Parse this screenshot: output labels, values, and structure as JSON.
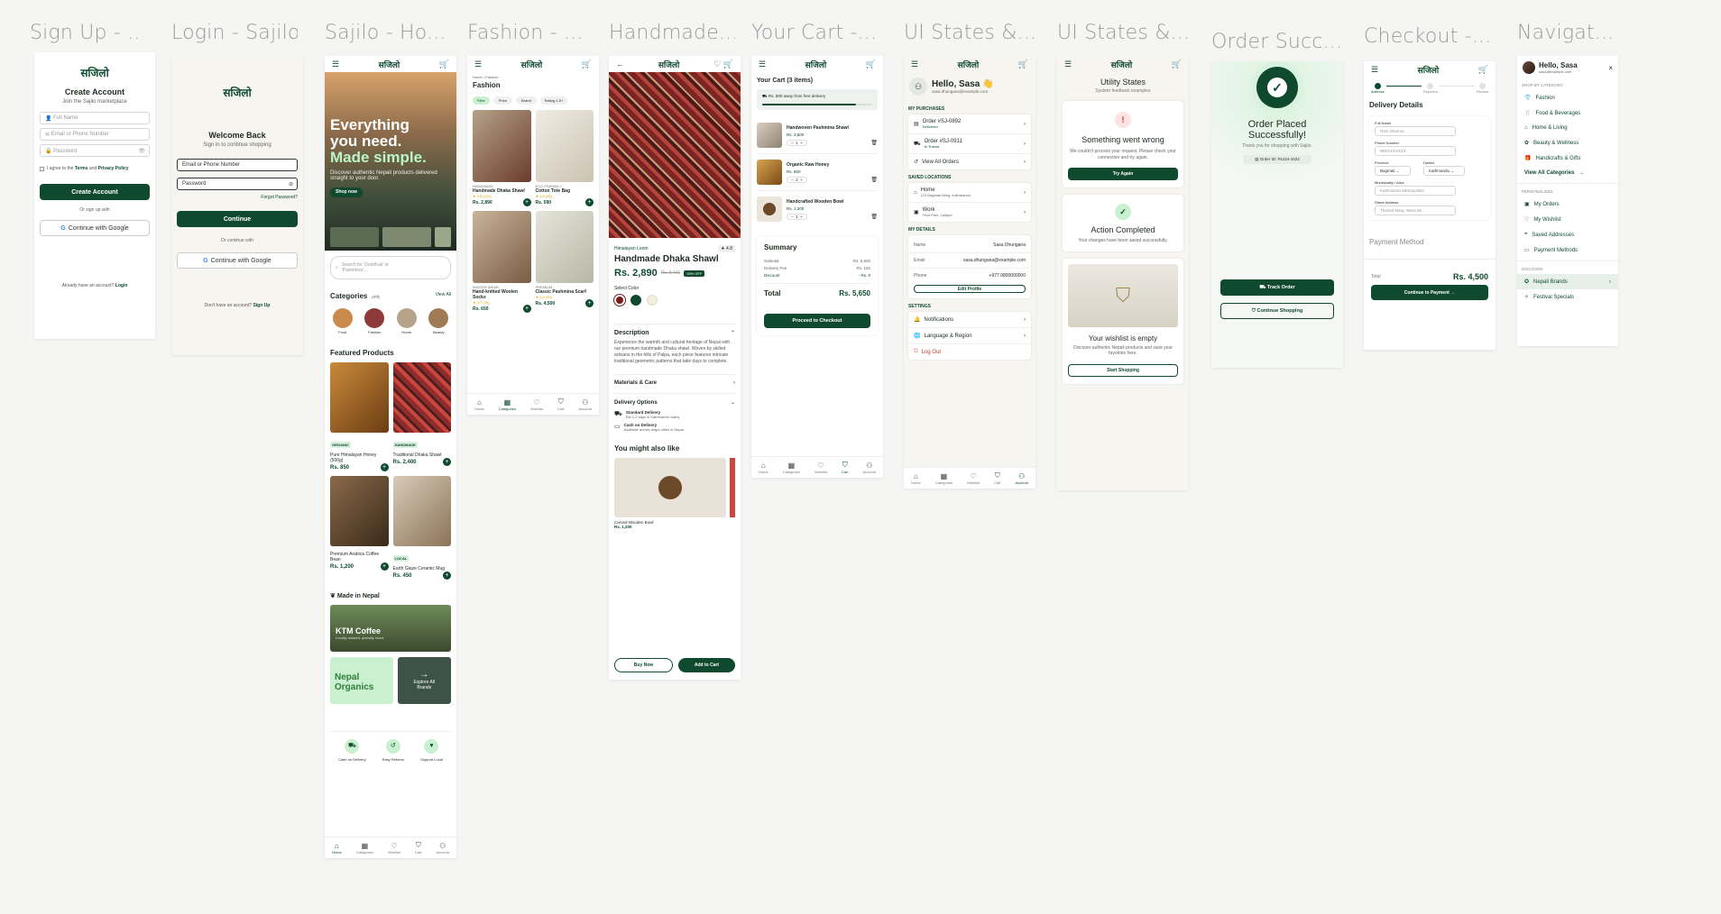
{
  "frames": {
    "titles": [
      "Sign Up - ...",
      "Login - Sajilo",
      "Sajilo - Ho...",
      "Fashion - ...",
      "Handmade...",
      "Your Cart -...",
      "UI States &...",
      "UI States &...",
      "Order Succ...",
      "Checkout -...",
      "Navigat..."
    ]
  },
  "brand": {
    "logo": "सजिलो",
    "accent": "#0f4a2f"
  },
  "signup": {
    "title": "Create Account",
    "subtitle": "Join the Sajilo marketplace",
    "full_name": "Full Name",
    "email_phone": "Email or Phone Number",
    "password": "Password",
    "terms_a": "I agree to the ",
    "terms_link": "Terms",
    "terms_b": " and ",
    "privacy_link": "Privacy Policy",
    "create_btn": "Create Account",
    "or_sign_up": "Or sign up with",
    "google_btn": "Continue with Google",
    "have_account": "Already have an account? ",
    "login_link": "Login"
  },
  "login": {
    "title": "Welcome Back",
    "subtitle": "Sign in to continue shopping",
    "email_phone": "Email or Phone Number",
    "password": "Password",
    "forgot": "Forgot Password?",
    "continue_btn": "Continue",
    "or_continue": "Or continue with",
    "google_btn": "Continue with Google",
    "no_account": "Don't have an account? ",
    "signup_link": "Sign Up"
  },
  "home": {
    "hero_l1": "Everything",
    "hero_l2": "you need.",
    "hero_l3": "Made simple.",
    "hero_sub": "Discover authentic Nepali products delivered straight to your door.",
    "hero_btn": "Shop now",
    "search_placeholder": "Search for 'Dundhak' or 'Pashmina'...",
    "categories_title": "Categories",
    "categories_sub": "(श्रेणी)",
    "view_all": "View All",
    "categories": [
      "Food",
      "Fashion",
      "Home",
      "Beauty"
    ],
    "featured_title": "Featured Products",
    "products": [
      {
        "tag": "ORGANIC",
        "name": "Pure Himalayan Honey (500g)",
        "price": "Rs. 850"
      },
      {
        "tag": "HANDMADE",
        "name": "Traditional Dhaka Shawl",
        "price": "Rs. 2,400"
      },
      {
        "tag": "",
        "name": "Premium Arabica Coffee Bean",
        "price": "Rs. 1,200"
      },
      {
        "tag": "LOCAL",
        "name": "Earth Glaze Ceramic Mug",
        "price": "Rs. 450"
      }
    ],
    "made_in_nepal": "Made in Nepal",
    "ktm_title": "KTM Coffee",
    "ktm_sub": "Locally roasted, globally loved",
    "nepal_organics": "Nepal Organics",
    "explore_brands": "Explore All Brands",
    "features": [
      "Cash on Delivery",
      "Easy Returns",
      "Support Local"
    ]
  },
  "nav": {
    "home": "Home",
    "categories": "Categories",
    "wishlist": "Wishlist",
    "cart": "Cart",
    "account": "Account"
  },
  "fashion": {
    "breadcrumb": "Home › Fashion",
    "title": "Fashion",
    "filters": [
      "Filter",
      "Price",
      "Brand",
      "Rating 4.5+"
    ],
    "products": [
      {
        "tag": "HANDMADE",
        "name": "Handmade Dhaka Shawl",
        "rating": "★ 4.8 (120)",
        "price": "Rs. 2,890"
      },
      {
        "tag": "ECO-FRIENDLY",
        "name": "Cotton Tote Bag",
        "rating": "★ 4.5 (80)",
        "price": "Rs. 590"
      },
      {
        "tag": "WINTER WEAR",
        "name": "Hand-knitted Woolen Socks",
        "rating": "★ 4.7 (95)",
        "price": "Rs. 650"
      },
      {
        "tag": "PREMIUM",
        "name": "Classic Pashmina Scarf",
        "rating": "★ 5.0 (45)",
        "price": "Rs. 4,500"
      }
    ]
  },
  "product": {
    "brand": "Himalayan Loom",
    "rating": "4.8",
    "name": "Handmade Dhaka Shawl",
    "price": "Rs. 2,890",
    "old_price": "Rs. 3,400",
    "discount": "15% OFF",
    "select_color": "Select Color",
    "description_title": "Description",
    "description": "Experience the warmth and cultural heritage of Nepal with our premium handmade Dhaka shawl. Woven by skilled artisans in the hills of Palpa, each piece features intricate traditional geometric patterns that take days to complete.",
    "materials": "Materials & Care",
    "delivery_options": "Delivery Options",
    "std_title": "Standard Delivery",
    "std_sub": "Est 1-2 days in Kathmandu Valley",
    "cod_title": "Cash on Delivery",
    "cod_sub": "Available across major cities in Nepal",
    "also_like": "You might also like",
    "rec_name": "Carved Wooden Bowl",
    "rec_price": "Rs. 1,200",
    "buy_now": "Buy Now",
    "add_cart": "Add to Cart"
  },
  "cart": {
    "title": "Your Cart (3 items)",
    "free_delivery": "Rs. 500 away from free delivery",
    "free_delivery_progress": 0.85,
    "items": [
      {
        "name": "Handwoven Pashmina Shawl",
        "price": "Rs. 3,500",
        "qty": "1"
      },
      {
        "name": "Organic Raw Honey",
        "price": "Rs. 800",
        "qty": "2"
      },
      {
        "name": "Handcrafted Wooden Bowl",
        "price": "Rs. 1,200",
        "qty": "1"
      }
    ],
    "summary": "Summary",
    "subtotal_l": "Subtotal",
    "subtotal_v": "Rs. 5,500",
    "delivery_l": "Delivery Fee",
    "delivery_v": "Rs. 150",
    "discount_l": "Discount",
    "discount_v": "- Rs. 0",
    "total_l": "Total",
    "total_v": "Rs. 5,650",
    "checkout_btn": "Proceed to Checkout"
  },
  "account": {
    "greeting": "Hello, Sasa 👋",
    "email": "sasa.dhungana@example.com",
    "my_purchases": "MY PURCHASES",
    "orders": [
      {
        "id": "Order #SJ-0892",
        "status": "Delivered"
      },
      {
        "id": "Order #SJ-0911",
        "status": "In Transit"
      }
    ],
    "view_all_orders": "View All Orders",
    "saved_locations": "SAVED LOCATIONS",
    "locations": [
      {
        "name": "Home",
        "addr": "123 Bagmati Marg, Kathmandu"
      },
      {
        "name": "Work",
        "addr": "Tech Park, Lalitpur"
      }
    ],
    "my_details": "MY DETAILS",
    "name_l": "Name",
    "name_v": "Sasa Dhungana",
    "email_l": "Email",
    "email_v": "sasa.dhungana@example.com",
    "phone_l": "Phone",
    "phone_v": "+977 9800000000",
    "edit_profile": "Edit Profile",
    "settings": "SETTINGS",
    "notifications": "Notifications",
    "language": "Language & Region",
    "logout": "Log Out"
  },
  "states": {
    "title": "Utility States",
    "subtitle": "System feedback examples",
    "error_title": "Something went wrong",
    "error_text": "We couldn't process your request. Please check your connection and try again.",
    "try_again": "Try Again",
    "success_title": "Action Completed",
    "success_text": "Your changes have been saved successfully.",
    "empty_title": "Your wishlist is empty",
    "empty_text": "Discover authentic Nepali products and save your favorites here.",
    "start_shopping": "Start Shopping"
  },
  "success": {
    "title": "Order Placed Successfully!",
    "subtitle": "Thank you for shopping with Sajilo.",
    "order_id": "Order ID: #SJ24-1024",
    "track_btn": "Track Order",
    "continue_btn": "Continue Shopping"
  },
  "checkout": {
    "steps": [
      "Address",
      "Payment",
      "Review"
    ],
    "delivery_title": "Delivery Details",
    "full_name_l": "Full Name",
    "full_name_v": "Ram Sharma",
    "phone_l": "Phone Number",
    "phone_v": "98XXXXXXXX",
    "province_l": "Province",
    "province_v": "Bagmati",
    "district_l": "District",
    "district_v": "Kathmandu",
    "municipality_l": "Municipality / Area",
    "municipality_v": "Kathmandu Metropolitan",
    "street_l": "Street Address",
    "street_v": "Thamel Marg, Ward 26",
    "payment_title": "Payment Method",
    "total_l": "Total",
    "total_v": "Rs. 4,500",
    "continue_btn": "Continue to Payment →"
  },
  "menu": {
    "greeting": "Hello, Sasa",
    "email": "sasa@example.com",
    "shop_by_category": "SHOP BY CATEGORY",
    "categories": [
      "Fashion",
      "Food & Beverages",
      "Home & Living",
      "Beauty & Wellness",
      "Handicrafts & Gifts"
    ],
    "view_all": "View All Categories",
    "personalized": "PERSONALIZED",
    "personal_items": [
      "My Orders",
      "My Wishlist",
      "Saved Addresses",
      "Payment Methods"
    ],
    "discover": "DISCOVER",
    "discover_items": [
      "Nepali Brands",
      "Festival Specials"
    ]
  }
}
